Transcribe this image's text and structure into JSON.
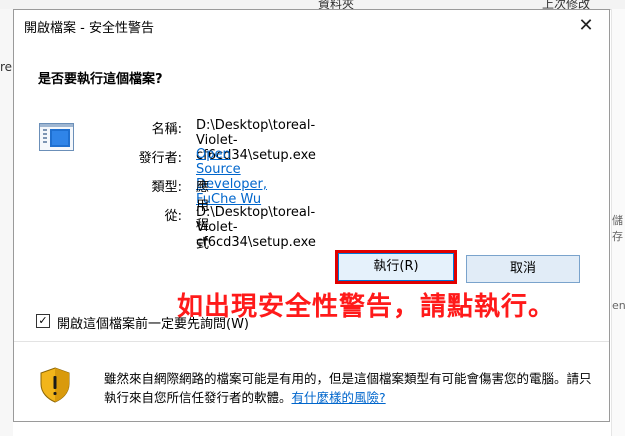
{
  "background": {
    "top_left_text": "資料夾",
    "top_right_text": "上次修改",
    "left_fragment": "re",
    "right_fragment_1": "儲存",
    "right_fragment_2": "en."
  },
  "dialog": {
    "title": "開啟檔案 - 安全性警告",
    "close_glyph": "✕",
    "question": "是否要執行這個檔案?",
    "app_icon": "application-window-icon",
    "details": {
      "name_label": "名稱:",
      "name_value": "D:\\Desktop\\toreal-Violet-cf6cd34\\setup.exe",
      "publisher_label": "發行者:",
      "publisher_value": "Open Source Developer, FuChe Wu",
      "type_label": "類型:",
      "type_value": "應用程式",
      "from_label": "從:",
      "from_value": "D:\\Desktop\\toreal-Violet-cf6cd34\\setup.exe"
    },
    "buttons": {
      "run_label": "執行(R)",
      "cancel_label": "取消"
    },
    "annotation": "如出現安全性警告，請點執行。",
    "checkbox": {
      "checked": true,
      "glyph": "✓",
      "label": "開啟這個檔案前一定要先詢問(W)"
    },
    "warning": {
      "icon": "shield-warning-icon",
      "text_part1": "雖然來自網際網路的檔案可能是有用的，但是這個檔案類型有可能會傷害您的電腦。請只執行來自您所信任發行者的軟體。",
      "link_text": "有什麼樣的風險?"
    }
  },
  "colors": {
    "link": "#0066cc",
    "annotation": "#ff1a1a",
    "run_highlight": "#e00000"
  }
}
